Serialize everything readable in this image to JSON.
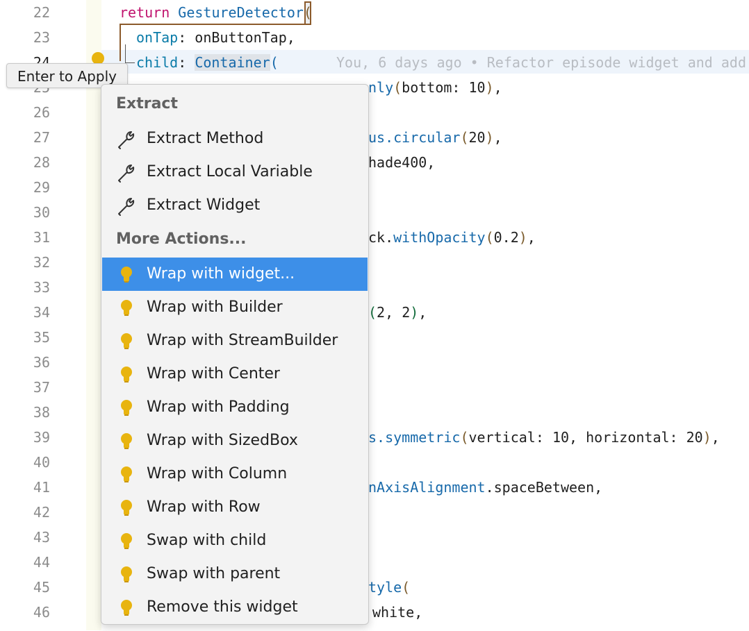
{
  "editor": {
    "line_numbers": [
      "22",
      "23",
      "24",
      "25",
      "26",
      "27",
      "28",
      "29",
      "30",
      "31",
      "32",
      "33",
      "34",
      "35",
      "36",
      "37",
      "38",
      "39",
      "40",
      "41",
      "42",
      "43",
      "44",
      "45",
      "46"
    ],
    "active_line": "24",
    "lines": {
      "l22": {
        "kw": "return",
        "cls": "GestureDetector",
        "paren": "("
      },
      "l23": {
        "prop": "onTap",
        "rest": ": onButtonTap,"
      },
      "l24": {
        "prop": "child",
        "sep": ": ",
        "cls": "Container",
        "paren": "(",
        "blame": "You, 6 days ago • Refactor episode widget and add"
      },
      "l25": {
        "pre": "nly",
        "paren1": "(",
        "prop": "bottom",
        "sep": ": ",
        "num": "10",
        "paren2": ")",
        "tail": ","
      },
      "l27": {
        "pre": "us.",
        "fn": "circular",
        "paren1": "(",
        "num": "20",
        "paren2": ")",
        "tail": ","
      },
      "l28": {
        "text": "hade400,"
      },
      "l31": {
        "pre": "ck.",
        "fn": "withOpacity",
        "paren1": "(",
        "num": "0.2",
        "paren2": ")",
        "tail": ","
      },
      "l34": {
        "paren1": "(",
        "num1": "2",
        "mid": ", ",
        "num2": "2",
        "paren2": ")",
        "tail": ","
      },
      "l39": {
        "pre": "s.",
        "fn": "symmetric",
        "paren1": "(",
        "p1": "vertical",
        "s1": ": ",
        "n1": "10",
        "m": ", ",
        "p2": "horizontal",
        "s2": ": ",
        "n2": "20",
        "paren2": ")",
        "tail": ","
      },
      "l41": {
        "cls": "nAxisAlignment",
        "rest": ".spaceBetween,"
      },
      "l45": {
        "cls": "tyle",
        "paren": "("
      },
      "l46": {
        "text": "white,"
      }
    }
  },
  "tooltip": {
    "text": "Enter to Apply"
  },
  "menu": {
    "extract_header": "Extract",
    "extract_items": [
      "Extract Method",
      "Extract Local Variable",
      "Extract Widget"
    ],
    "more_header": "More Actions...",
    "more_items": [
      "Wrap with widget...",
      "Wrap with Builder",
      "Wrap with StreamBuilder",
      "Wrap with Center",
      "Wrap with Padding",
      "Wrap with SizedBox",
      "Wrap with Column",
      "Wrap with Row",
      "Swap with child",
      "Swap with parent",
      "Remove this widget"
    ],
    "selected_item": "Wrap with widget..."
  },
  "colors": {
    "selected_bg": "#3d8fe8",
    "bulb": "#e8b40f",
    "keyword": "#c0136e",
    "class": "#1769aa"
  },
  "icons": {
    "extract": "wrench-icon",
    "action": "lightbulb-icon"
  }
}
